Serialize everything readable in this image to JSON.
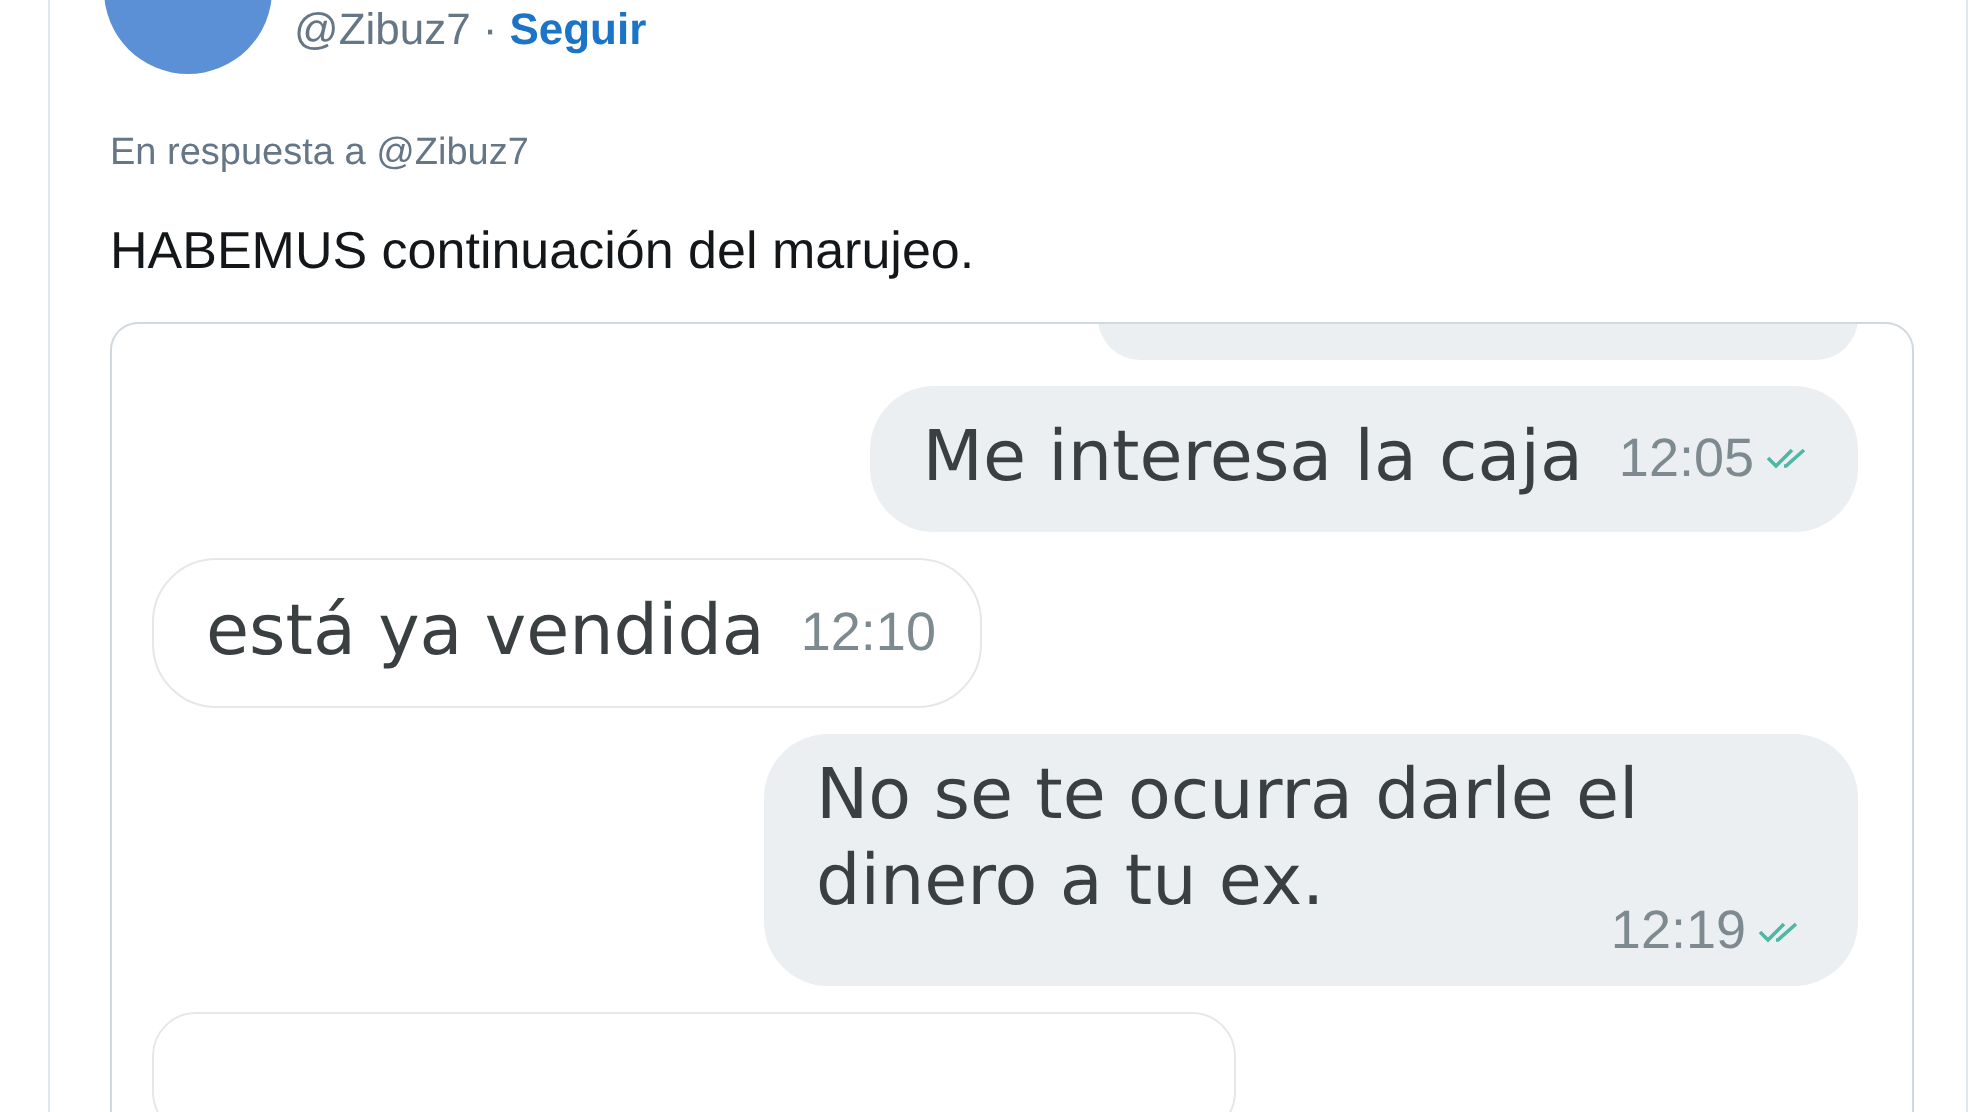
{
  "author": {
    "handle": "@Zibuz7",
    "separator": "·",
    "follow": "Seguir"
  },
  "reply_to": "En respuesta a @Zibuz7",
  "text": "HABEMUS continuación del marujeo.",
  "chat": {
    "messages": [
      {
        "kind": "clipped",
        "from_me": true
      },
      {
        "kind": "outgoing",
        "text": "Me interesa la caja",
        "time": "12:05",
        "read": true
      },
      {
        "kind": "incoming",
        "text": "está ya vendida",
        "time": "12:10"
      },
      {
        "kind": "outgoing",
        "text": "No se te ocurra darle el dinero a tu ex.",
        "time": "12:19",
        "read": true
      },
      {
        "kind": "clipped",
        "from_me": false
      }
    ]
  }
}
